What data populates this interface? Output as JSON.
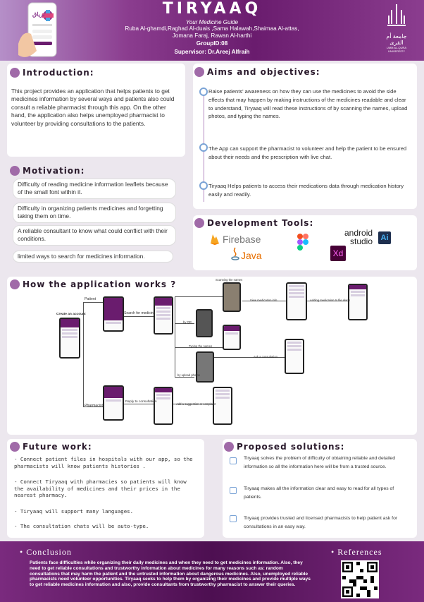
{
  "header": {
    "title": "TIRYAAQ",
    "subtitle": "Your Medicine Guide",
    "authors_line1": "Ruba Al-ghamdi,Raghad Al-duais ,Sama Halawah,Shaimaa Al-attas,",
    "authors_line2": "Jomana  Faraj, Rawan  Al-harthi",
    "group": "GroupID:08",
    "supervisor": "Supervisor: Dr.Areej Alfraih",
    "university_ar": "جامعة أم القرى",
    "university_en": "UMM AL-QURA UNIVERSITY",
    "app_logo_text": "ترياق"
  },
  "introduction": {
    "heading": "Introduction:",
    "text": "This project provides an application that helps patients to get medicines information by several ways and patients also could consult a reliable pharmacist through this app. On the other hand, the application also helps unemployed pharmacist to volunteer by providing consultations to the patients."
  },
  "motivation": {
    "heading": "Motivation:",
    "items": [
      "Difficulty of reading medicine information leaflets because of the small font within it.",
      "Difficulty in organizing patients medicines and forgetting taking them on time.",
      " A reliable consultant to know what could conflict with their conditions.",
      "limited ways to search for medicines information."
    ]
  },
  "aims": {
    "heading": "Aims and objectives:",
    "items": [
      " Raise patients' awareness on how they can use the medicines to avoid the side effects that may happen by making instructions of the medicines readable and clear to understand, Tiryaaq will read these instructions of by scanning the names, upload photos, and typing the names.",
      "The App can support the pharmacist to volunteer and help the patient to be ensured about their needs and the prescription with live chat.",
      "Tiryaaq Helps patients to access their medications data through medication history easily and readily."
    ]
  },
  "tools": {
    "heading": "Development Tools:",
    "firebase": "Firebase",
    "java": "Java",
    "android_studio_1": "android",
    "android_studio_2": "studio",
    "ai": "Ai",
    "xd": "Xd"
  },
  "how": {
    "heading": "How the application works ?",
    "labels": {
      "create_account": "Create an account",
      "patient": "Patient",
      "search": "Search for medicine",
      "scanning": "Scanning the names",
      "by_qr": "by QR",
      "typing": "Typing the names",
      "upload": "by upload photos",
      "view_info": "View medication info",
      "adding": "Adding medication to file alarm",
      "ask": "Ask a consultation",
      "pharmacist": "Pharmacist",
      "reply": "Reply to consultation",
      "suggestion": "Add a suggestion or complaint"
    }
  },
  "future": {
    "heading": "Future work:",
    "items": [
      "-  Connect patient files in hospitals with our app, so the pharmacists will know patients histories .",
      "- Connect Tiryaaq with pharmacies so patients will know the availability of medicines and their prices in the nearest pharmacy.",
      "- Tiryaaq will support many languages.",
      "-  The consultation chats will be auto-type."
    ]
  },
  "proposed": {
    "heading": "Proposed solutions:",
    "items": [
      "Tiryaaq solves the problem of difficulty of obtaining reliable and detailed information so all the information here will be from a trusted source.",
      "Tiryaaq makes all the information clear and easy to read for all types of patients.",
      "Tiryaaq provides trusted and licensed pharmacists to help patient ask for consultations in an easy way."
    ]
  },
  "conclusion": {
    "heading": "• Conclusion",
    "text": "Patients face difficulties while organizing their daily medicines and when they need to get medicines information. Also, they need to get reliable consultations and trustworthy information about medicines for many reasons such as: random consultations that may harm the patient and the untrusted information about dangerous medicines. Also, unemployed reliable pharmacists need volunteer opportunities. Tiryaaq seeks to help them by organizing their medicines and provide multiple ways to get reliable medicines information and also, provide consultants from trustworthy pharmacist to answer their queries."
  },
  "references": {
    "heading": "• References"
  }
}
